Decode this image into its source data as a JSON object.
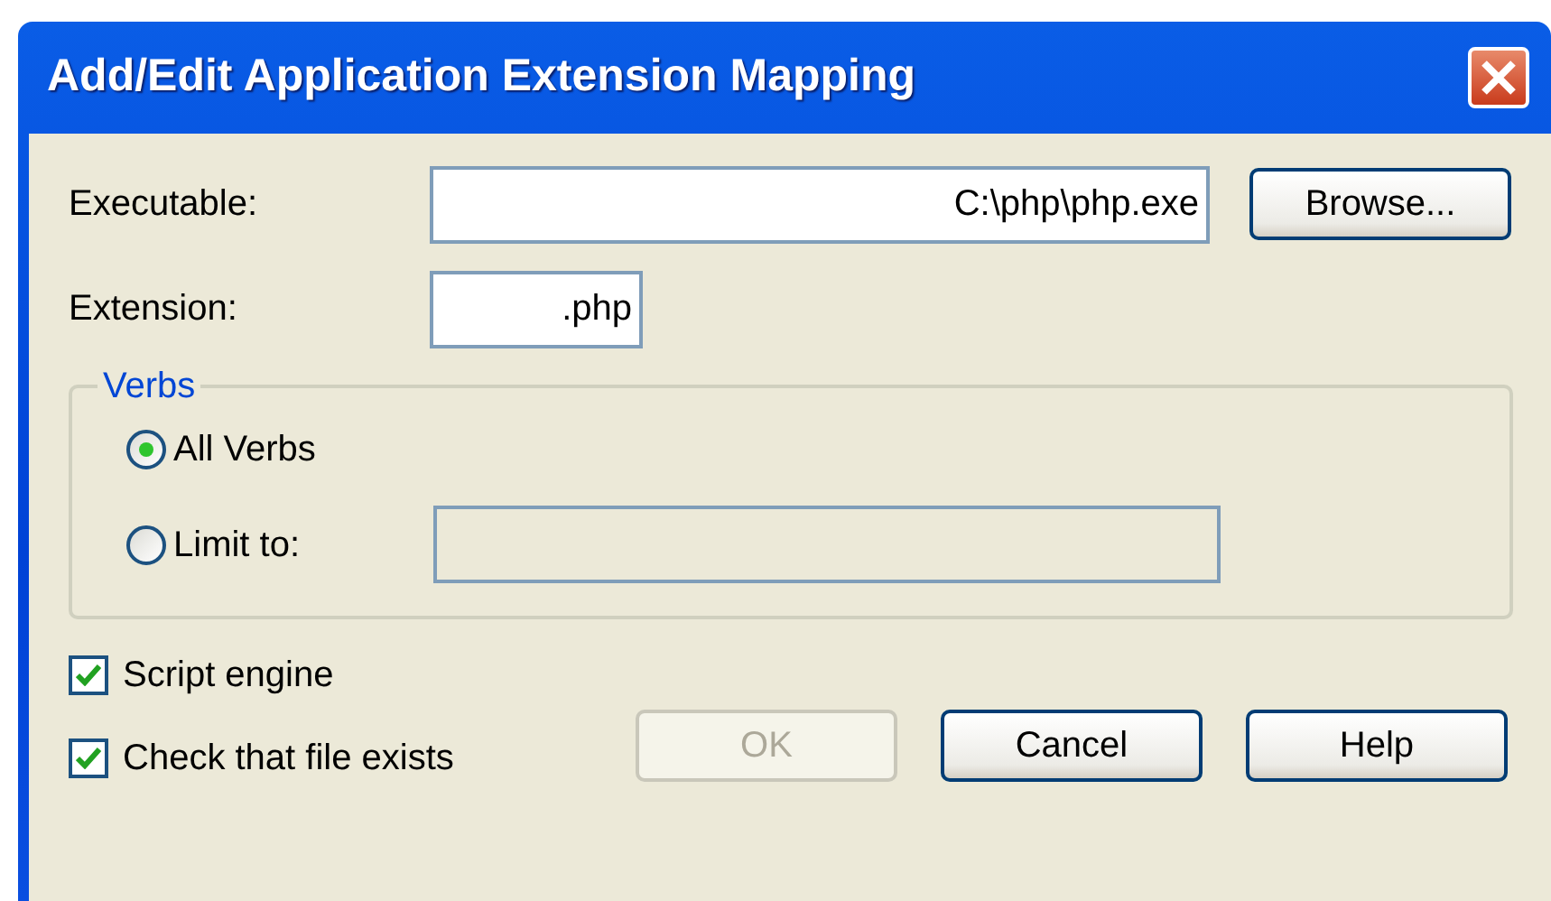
{
  "window": {
    "title": "Add/Edit Application Extension Mapping"
  },
  "fields": [
    {
      "label": "Executable:",
      "value": "C:\\php\\php.exe"
    },
    {
      "label": "Extension:",
      "value": ".php"
    }
  ],
  "browse_button": {
    "label": "Browse..."
  },
  "verbs": {
    "legend": "Verbs",
    "options": [
      {
        "label": "All Verbs",
        "selected": true
      },
      {
        "label": "Limit to:",
        "selected": false
      }
    ]
  },
  "checkboxes": [
    {
      "label": "Script engine",
      "checked": true
    },
    {
      "label": "Check that file exists",
      "checked": true
    }
  ],
  "buttons": [
    {
      "label": "OK",
      "disabled": true
    },
    {
      "label": "Cancel",
      "disabled": false
    },
    {
      "label": "Help",
      "disabled": false
    }
  ]
}
